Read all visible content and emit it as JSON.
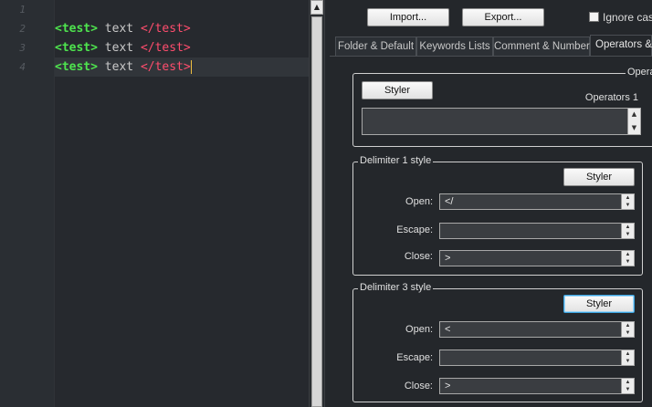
{
  "editor": {
    "line_numbers": [
      "1",
      "2",
      "3",
      "4"
    ],
    "lines": [
      {
        "open": "",
        "text": "",
        "close": ""
      },
      {
        "open": "<test>",
        "text": " text ",
        "close": "</test>"
      },
      {
        "open": "<test>",
        "text": " text ",
        "close": "</test>"
      },
      {
        "open": "<test>",
        "text": " text ",
        "close": "</test>"
      }
    ]
  },
  "toolbar": {
    "import_label": "Import...",
    "export_label": "Export...",
    "ignore_case_label": "Ignore case"
  },
  "tabs": [
    {
      "label": "Folder & Default"
    },
    {
      "label": "Keywords Lists"
    },
    {
      "label": "Comment & Number"
    },
    {
      "label": "Operators &"
    }
  ],
  "operators_group": {
    "legend": "Opera",
    "styler_label": "Styler",
    "operators_label": "Operators 1",
    "operators_value": ""
  },
  "delimiter1": {
    "legend": "Delimiter 1 style",
    "styler_label": "Styler",
    "open_label": "Open:",
    "open_value": "</",
    "escape_label": "Escape:",
    "escape_value": "",
    "close_label": "Close:",
    "close_value": ">"
  },
  "delimiter3": {
    "legend": "Delimiter 3 style",
    "styler_label": "Styler",
    "open_label": "Open:",
    "open_value": "<",
    "escape_label": "Escape:",
    "escape_value": "",
    "close_label": "Close:",
    "close_value": ">"
  },
  "colors": {
    "tag_open": "#4ee44e",
    "tag_close": "#ff4d6d",
    "caret": "#f0c040",
    "focus_border": "#3aa3e0"
  }
}
